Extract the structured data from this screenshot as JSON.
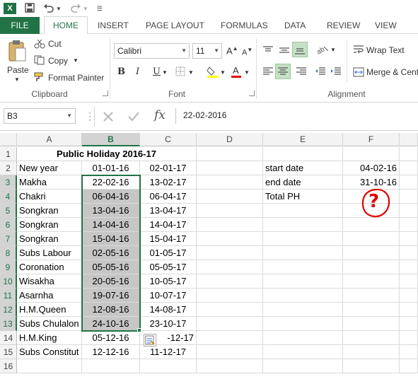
{
  "app": {
    "logo": "X",
    "brand_color": "#217346"
  },
  "qat": {
    "save_icon": "save-icon",
    "undo_icon": "undo-icon",
    "redo_icon": "redo-icon"
  },
  "tabs": [
    "FILE",
    "HOME",
    "INSERT",
    "PAGE LAYOUT",
    "FORMULAS",
    "DATA",
    "REVIEW",
    "VIEW"
  ],
  "active_tab": "HOME",
  "ribbon": {
    "clipboard": {
      "label": "Clipboard",
      "paste": "Paste",
      "cut": "Cut",
      "copy": "Copy",
      "format_painter": "Format Painter"
    },
    "font": {
      "label": "Font",
      "name": "Calibri",
      "size": "11",
      "bold": "B",
      "italic": "I",
      "underline": "U"
    },
    "alignment": {
      "label": "Alignment",
      "wrap_text": "Wrap Text",
      "merge_center": "Merge & Cent"
    }
  },
  "formula_bar": {
    "name_box": "B3",
    "fx": "fx",
    "value": "22-02-2016"
  },
  "columns": [
    "A",
    "B",
    "C",
    "D",
    "E",
    "F"
  ],
  "selected_column": "B",
  "rows": [
    "1",
    "2",
    "3",
    "4",
    "5",
    "6",
    "7",
    "8",
    "9",
    "10",
    "11",
    "12",
    "13",
    "14",
    "15",
    "16"
  ],
  "selected_rows": [
    "3",
    "4",
    "5",
    "6",
    "7",
    "8",
    "9",
    "10",
    "11",
    "12",
    "13"
  ],
  "cells": {
    "title": "Public Holiday 2016-17",
    "A": [
      "",
      "New year",
      "Makha",
      "Chakri",
      "Songkran",
      "Songkran",
      "Songkran",
      "Subs Labour",
      "Coronation",
      "Wisakha",
      "Asarnha",
      "H.M.Queen",
      "Subs Chulalon",
      "H.M.King",
      "Subs Constitut",
      ""
    ],
    "B": [
      "",
      "01-01-16",
      "22-02-16",
      "06-04-16",
      "13-04-16",
      "14-04-16",
      "15-04-16",
      "02-05-16",
      "05-05-16",
      "20-05-16",
      "19-07-16",
      "12-08-16",
      "24-10-16",
      "05-12-16",
      "12-12-16",
      ""
    ],
    "C": [
      "",
      "02-01-17",
      "13-02-17",
      "06-04-17",
      "13-04-17",
      "14-04-17",
      "15-04-17",
      "01-05-17",
      "05-05-17",
      "10-05-17",
      "10-07-17",
      "14-08-17",
      "23-10-17",
      "-12-17",
      "11-12-17",
      ""
    ],
    "E": [
      "",
      "start date",
      "end date",
      "Total PH",
      "",
      "",
      "",
      "",
      "",
      "",
      "",
      "",
      "",
      "",
      "",
      ""
    ],
    "F": [
      "",
      "04-02-16",
      "31-10-16",
      "",
      "",
      "",
      "",
      "",
      "",
      "",
      "",
      "",
      "",
      "",
      "",
      ""
    ]
  },
  "annotation": "?",
  "annotation_color": "#e00000",
  "selection_color": "#217346",
  "highlight_color": "#c6c6c6"
}
